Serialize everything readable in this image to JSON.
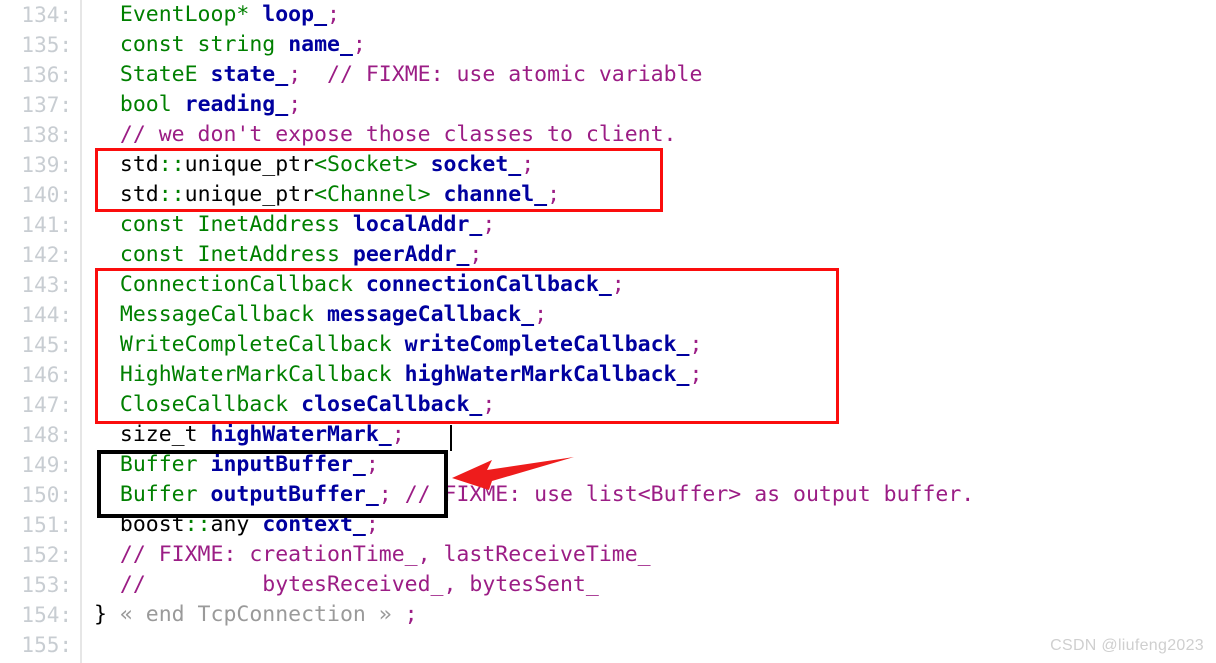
{
  "editor": {
    "language": "cpp",
    "first_line_number": 134,
    "line_number_suffix": ":",
    "background_color": "#ffffff",
    "gutter_text_color": "#c8cdd2",
    "type_color": "#008000",
    "identifier_color": "#00009f",
    "comment_color": "#9b1d85",
    "plain_color": "#000000",
    "fold_color": "#9a9a9a"
  },
  "gutter": {
    "numbers": [
      "134:",
      "135:",
      "136:",
      "137:",
      "138:",
      "139:",
      "140:",
      "141:",
      "142:",
      "143:",
      "144:",
      "145:",
      "146:",
      "147:",
      "148:",
      "149:",
      "150:",
      "151:",
      "152:",
      "153:",
      "154:",
      "155:"
    ]
  },
  "lines": [
    {
      "number": "134:",
      "text": "  EventLoop* loop_;",
      "tokens": [
        {
          "t": "  ",
          "c": "plain"
        },
        {
          "t": "EventLoop*",
          "c": "type"
        },
        {
          "t": " ",
          "c": "plain"
        },
        {
          "t": "loop_",
          "c": "ident"
        },
        {
          "t": ";",
          "c": "punct"
        }
      ]
    },
    {
      "number": "135:",
      "text": "  const string name_;",
      "tokens": [
        {
          "t": "  ",
          "c": "plain"
        },
        {
          "t": "const string",
          "c": "type"
        },
        {
          "t": " ",
          "c": "plain"
        },
        {
          "t": "name_",
          "c": "ident"
        },
        {
          "t": ";",
          "c": "punct"
        }
      ]
    },
    {
      "number": "136:",
      "text": "  StateE state_;  // FIXME: use atomic variable",
      "tokens": [
        {
          "t": "  ",
          "c": "plain"
        },
        {
          "t": "StateE",
          "c": "type"
        },
        {
          "t": " ",
          "c": "plain"
        },
        {
          "t": "state_",
          "c": "ident"
        },
        {
          "t": ";",
          "c": "punct"
        },
        {
          "t": "  ",
          "c": "plain"
        },
        {
          "t": "// FIXME: use atomic variable",
          "c": "comment"
        }
      ]
    },
    {
      "number": "137:",
      "text": "  bool reading_;",
      "tokens": [
        {
          "t": "  ",
          "c": "plain"
        },
        {
          "t": "bool",
          "c": "type"
        },
        {
          "t": " ",
          "c": "plain"
        },
        {
          "t": "reading_",
          "c": "ident"
        },
        {
          "t": ";",
          "c": "punct"
        }
      ]
    },
    {
      "number": "138:",
      "text": "  // we don't expose those classes to client.",
      "tokens": [
        {
          "t": "  ",
          "c": "plain"
        },
        {
          "t": "// we don't expose those classes to client.",
          "c": "comment"
        }
      ]
    },
    {
      "number": "139:",
      "text": "  std::unique_ptr<Socket> socket_;",
      "tokens": [
        {
          "t": "  ",
          "c": "plain"
        },
        {
          "t": "std",
          "c": "plain"
        },
        {
          "t": "::",
          "c": "op"
        },
        {
          "t": "unique_ptr",
          "c": "plain"
        },
        {
          "t": "<Socket>",
          "c": "type"
        },
        {
          "t": " ",
          "c": "plain"
        },
        {
          "t": "socket_",
          "c": "ident"
        },
        {
          "t": ";",
          "c": "punct"
        }
      ]
    },
    {
      "number": "140:",
      "text": "  std::unique_ptr<Channel> channel_;",
      "tokens": [
        {
          "t": "  ",
          "c": "plain"
        },
        {
          "t": "std",
          "c": "plain"
        },
        {
          "t": "::",
          "c": "op"
        },
        {
          "t": "unique_ptr",
          "c": "plain"
        },
        {
          "t": "<Channel>",
          "c": "type"
        },
        {
          "t": " ",
          "c": "plain"
        },
        {
          "t": "channel_",
          "c": "ident"
        },
        {
          "t": ";",
          "c": "punct"
        }
      ]
    },
    {
      "number": "141:",
      "text": "  const InetAddress localAddr_;",
      "tokens": [
        {
          "t": "  ",
          "c": "plain"
        },
        {
          "t": "const InetAddress",
          "c": "type"
        },
        {
          "t": " ",
          "c": "plain"
        },
        {
          "t": "localAddr_",
          "c": "ident"
        },
        {
          "t": ";",
          "c": "punct"
        }
      ]
    },
    {
      "number": "142:",
      "text": "  const InetAddress peerAddr_;",
      "tokens": [
        {
          "t": "  ",
          "c": "plain"
        },
        {
          "t": "const InetAddress",
          "c": "type"
        },
        {
          "t": " ",
          "c": "plain"
        },
        {
          "t": "peerAddr_",
          "c": "ident"
        },
        {
          "t": ";",
          "c": "punct"
        }
      ]
    },
    {
      "number": "143:",
      "text": "  ConnectionCallback connectionCallback_;",
      "tokens": [
        {
          "t": "  ",
          "c": "plain"
        },
        {
          "t": "ConnectionCallback",
          "c": "type"
        },
        {
          "t": " ",
          "c": "plain"
        },
        {
          "t": "connectionCallback_",
          "c": "ident"
        },
        {
          "t": ";",
          "c": "punct"
        }
      ]
    },
    {
      "number": "144:",
      "text": "  MessageCallback messageCallback_;",
      "tokens": [
        {
          "t": "  ",
          "c": "plain"
        },
        {
          "t": "MessageCallback",
          "c": "type"
        },
        {
          "t": " ",
          "c": "plain"
        },
        {
          "t": "messageCallback_",
          "c": "ident"
        },
        {
          "t": ";",
          "c": "punct"
        }
      ]
    },
    {
      "number": "145:",
      "text": "  WriteCompleteCallback writeCompleteCallback_;",
      "tokens": [
        {
          "t": "  ",
          "c": "plain"
        },
        {
          "t": "WriteCompleteCallback",
          "c": "type"
        },
        {
          "t": " ",
          "c": "plain"
        },
        {
          "t": "writeCompleteCallback_",
          "c": "ident"
        },
        {
          "t": ";",
          "c": "punct"
        }
      ]
    },
    {
      "number": "146:",
      "text": "  HighWaterMarkCallback highWaterMarkCallback_;",
      "tokens": [
        {
          "t": "  ",
          "c": "plain"
        },
        {
          "t": "HighWaterMarkCallback",
          "c": "type"
        },
        {
          "t": " ",
          "c": "plain"
        },
        {
          "t": "highWaterMarkCallback_",
          "c": "ident"
        },
        {
          "t": ";",
          "c": "punct"
        }
      ]
    },
    {
      "number": "147:",
      "text": "  CloseCallback closeCallback_;",
      "tokens": [
        {
          "t": "  ",
          "c": "plain"
        },
        {
          "t": "CloseCallback",
          "c": "type"
        },
        {
          "t": " ",
          "c": "plain"
        },
        {
          "t": "closeCallback_",
          "c": "ident"
        },
        {
          "t": ";",
          "c": "punct"
        }
      ]
    },
    {
      "number": "148:",
      "text": "  size_t highWaterMark_;",
      "tokens": [
        {
          "t": "  ",
          "c": "plain"
        },
        {
          "t": "size_t",
          "c": "plain"
        },
        {
          "t": " ",
          "c": "plain"
        },
        {
          "t": "highWaterMark_",
          "c": "ident"
        },
        {
          "t": ";",
          "c": "punct"
        }
      ]
    },
    {
      "number": "149:",
      "text": "  Buffer inputBuffer_;",
      "tokens": [
        {
          "t": "  ",
          "c": "plain"
        },
        {
          "t": "Buffer",
          "c": "type"
        },
        {
          "t": " ",
          "c": "plain"
        },
        {
          "t": "inputBuffer_",
          "c": "ident"
        },
        {
          "t": ";",
          "c": "punct"
        }
      ]
    },
    {
      "number": "150:",
      "text": "  Buffer outputBuffer_; // FIXME: use list<Buffer> as output buffer.",
      "tokens": [
        {
          "t": "  ",
          "c": "plain"
        },
        {
          "t": "Buffer",
          "c": "type"
        },
        {
          "t": " ",
          "c": "plain"
        },
        {
          "t": "outputBuffer_",
          "c": "ident"
        },
        {
          "t": ";",
          "c": "punct"
        },
        {
          "t": " ",
          "c": "plain"
        },
        {
          "t": "// FIXME: use list<Buffer> as output buffer.",
          "c": "comment"
        }
      ]
    },
    {
      "number": "151:",
      "text": "  boost::any context_;",
      "tokens": [
        {
          "t": "  ",
          "c": "plain"
        },
        {
          "t": "boost",
          "c": "plain"
        },
        {
          "t": "::",
          "c": "op"
        },
        {
          "t": "any",
          "c": "plain"
        },
        {
          "t": " ",
          "c": "plain"
        },
        {
          "t": "context_",
          "c": "ident"
        },
        {
          "t": ";",
          "c": "punct"
        }
      ]
    },
    {
      "number": "152:",
      "text": "  // FIXME: creationTime_, lastReceiveTime_",
      "tokens": [
        {
          "t": "  ",
          "c": "plain"
        },
        {
          "t": "// FIXME: creationTime_, lastReceiveTime_",
          "c": "comment"
        }
      ]
    },
    {
      "number": "153:",
      "text": "  //         bytesReceived_, bytesSent_",
      "tokens": [
        {
          "t": "  ",
          "c": "plain"
        },
        {
          "t": "//         bytesReceived_, bytesSent_",
          "c": "comment"
        }
      ]
    },
    {
      "number": "154:",
      "text": "} « end TcpConnection » ;",
      "tokens": [
        {
          "t": "}",
          "c": "plain"
        },
        {
          "t": " « end TcpConnection » ",
          "c": "fold"
        },
        {
          "t": ";",
          "c": "punct"
        }
      ]
    },
    {
      "number": "155:",
      "text": "",
      "tokens": []
    }
  ],
  "annotations": {
    "red_box_1": {
      "label": "smart-pointer-members-highlight",
      "color": "#fb0d0d"
    },
    "red_box_2": {
      "label": "callback-members-highlight",
      "color": "#fb0d0d"
    },
    "black_box": {
      "label": "buffer-members-highlight",
      "color": "#000000"
    },
    "arrow": {
      "label": "buffer-members-arrow",
      "color": "#ee1c1c"
    }
  },
  "watermark": {
    "text": "CSDN @liufeng2023"
  }
}
